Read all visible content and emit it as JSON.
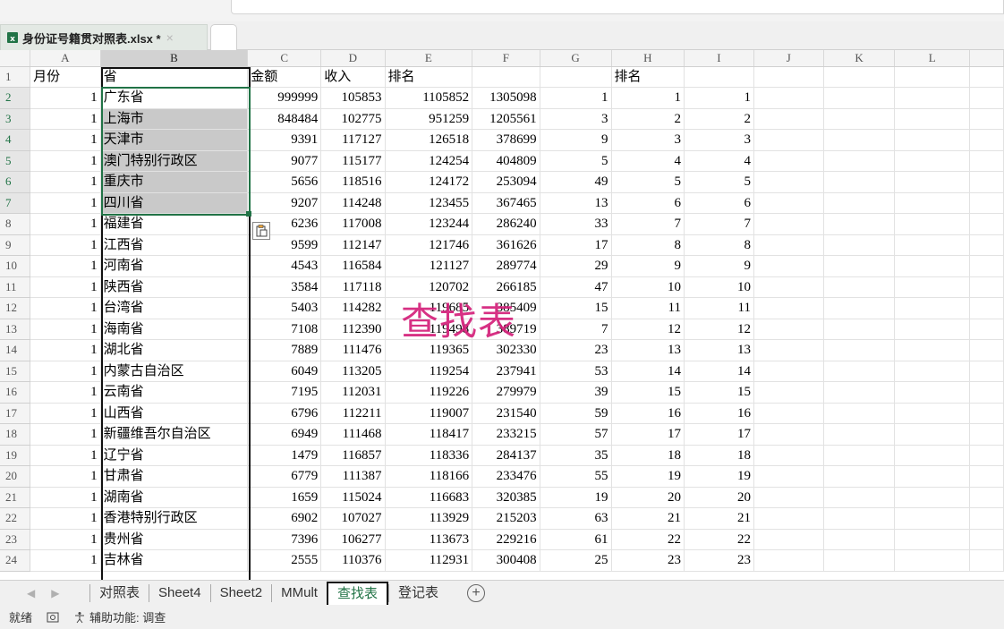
{
  "file_tab": {
    "title": "身份证号籍贯对照表.xlsx *",
    "close": "×"
  },
  "columns": [
    "A",
    "B",
    "C",
    "D",
    "E",
    "F",
    "G",
    "H",
    "I",
    "J",
    "K",
    "L"
  ],
  "header_row": {
    "row": "1",
    "A": "月份",
    "B": "省",
    "C": "金额",
    "D": "收入",
    "E": "排名",
    "F": "",
    "G": "",
    "H": "排名",
    "I": ""
  },
  "rows": [
    {
      "row": "2",
      "A": "1",
      "B": "广东省",
      "C": "999999",
      "D": "105853",
      "E": "1105852",
      "F": "1305098",
      "G": "1",
      "H": "1",
      "I": "1"
    },
    {
      "row": "3",
      "A": "1",
      "B": "上海市",
      "C": "848484",
      "D": "102775",
      "E": "951259",
      "F": "1205561",
      "G": "3",
      "H": "2",
      "I": "2"
    },
    {
      "row": "4",
      "A": "1",
      "B": "天津市",
      "C": "9391",
      "D": "117127",
      "E": "126518",
      "F": "378699",
      "G": "9",
      "H": "3",
      "I": "3"
    },
    {
      "row": "5",
      "A": "1",
      "B": "澳门特别行政区",
      "C": "9077",
      "D": "115177",
      "E": "124254",
      "F": "404809",
      "G": "5",
      "H": "4",
      "I": "4"
    },
    {
      "row": "6",
      "A": "1",
      "B": "重庆市",
      "C": "5656",
      "D": "118516",
      "E": "124172",
      "F": "253094",
      "G": "49",
      "H": "5",
      "I": "5"
    },
    {
      "row": "7",
      "A": "1",
      "B": "四川省",
      "C": "9207",
      "D": "114248",
      "E": "123455",
      "F": "367465",
      "G": "13",
      "H": "6",
      "I": "6"
    },
    {
      "row": "8",
      "A": "1",
      "B": "福建省",
      "C": "6236",
      "D": "117008",
      "E": "123244",
      "F": "286240",
      "G": "33",
      "H": "7",
      "I": "7"
    },
    {
      "row": "9",
      "A": "1",
      "B": "江西省",
      "C": "9599",
      "D": "112147",
      "E": "121746",
      "F": "361626",
      "G": "17",
      "H": "8",
      "I": "8"
    },
    {
      "row": "10",
      "A": "1",
      "B": "河南省",
      "C": "4543",
      "D": "116584",
      "E": "121127",
      "F": "289774",
      "G": "29",
      "H": "9",
      "I": "9"
    },
    {
      "row": "11",
      "A": "1",
      "B": "陕西省",
      "C": "3584",
      "D": "117118",
      "E": "120702",
      "F": "266185",
      "G": "47",
      "H": "10",
      "I": "10"
    },
    {
      "row": "12",
      "A": "1",
      "B": "台湾省",
      "C": "5403",
      "D": "114282",
      "E": "119685",
      "F": "385409",
      "G": "15",
      "H": "11",
      "I": "11"
    },
    {
      "row": "13",
      "A": "1",
      "B": "海南省",
      "C": "7108",
      "D": "112390",
      "E": "119498",
      "F": "389719",
      "G": "7",
      "H": "12",
      "I": "12"
    },
    {
      "row": "14",
      "A": "1",
      "B": "湖北省",
      "C": "7889",
      "D": "111476",
      "E": "119365",
      "F": "302330",
      "G": "23",
      "H": "13",
      "I": "13"
    },
    {
      "row": "15",
      "A": "1",
      "B": "内蒙古自治区",
      "C": "6049",
      "D": "113205",
      "E": "119254",
      "F": "237941",
      "G": "53",
      "H": "14",
      "I": "14"
    },
    {
      "row": "16",
      "A": "1",
      "B": "云南省",
      "C": "7195",
      "D": "112031",
      "E": "119226",
      "F": "279979",
      "G": "39",
      "H": "15",
      "I": "15"
    },
    {
      "row": "17",
      "A": "1",
      "B": "山西省",
      "C": "6796",
      "D": "112211",
      "E": "119007",
      "F": "231540",
      "G": "59",
      "H": "16",
      "I": "16"
    },
    {
      "row": "18",
      "A": "1",
      "B": "新疆维吾尔自治区",
      "C": "6949",
      "D": "111468",
      "E": "118417",
      "F": "233215",
      "G": "57",
      "H": "17",
      "I": "17"
    },
    {
      "row": "19",
      "A": "1",
      "B": "辽宁省",
      "C": "1479",
      "D": "116857",
      "E": "118336",
      "F": "284137",
      "G": "35",
      "H": "18",
      "I": "18"
    },
    {
      "row": "20",
      "A": "1",
      "B": "甘肃省",
      "C": "6779",
      "D": "111387",
      "E": "118166",
      "F": "233476",
      "G": "55",
      "H": "19",
      "I": "19"
    },
    {
      "row": "21",
      "A": "1",
      "B": "湖南省",
      "C": "1659",
      "D": "115024",
      "E": "116683",
      "F": "320385",
      "G": "19",
      "H": "20",
      "I": "20"
    },
    {
      "row": "22",
      "A": "1",
      "B": "香港特别行政区",
      "C": "6902",
      "D": "107027",
      "E": "113929",
      "F": "215203",
      "G": "63",
      "H": "21",
      "I": "21"
    },
    {
      "row": "23",
      "A": "1",
      "B": "贵州省",
      "C": "7396",
      "D": "106277",
      "E": "113673",
      "F": "229216",
      "G": "61",
      "H": "22",
      "I": "22"
    },
    {
      "row": "24",
      "A": "1",
      "B": "吉林省",
      "C": "2555",
      "D": "110376",
      "E": "112931",
      "F": "300408",
      "G": "25",
      "H": "23",
      "I": "23"
    }
  ],
  "watermark": "查找表",
  "sheet_tabs": [
    "对照表",
    "Sheet4",
    "Sheet2",
    "MMult",
    "查找表",
    "登记表"
  ],
  "active_sheet": "查找表",
  "status": {
    "ready": "就绪",
    "accessibility": "辅助功能: 调查"
  },
  "colors": {
    "accent": "#217346",
    "watermark": "#d4207a",
    "selection": "#c9c9c9"
  },
  "icons": [
    "xlsx-file-icon",
    "paste-options-icon",
    "add-sheet-icon",
    "macro-record-icon",
    "accessibility-icon"
  ]
}
